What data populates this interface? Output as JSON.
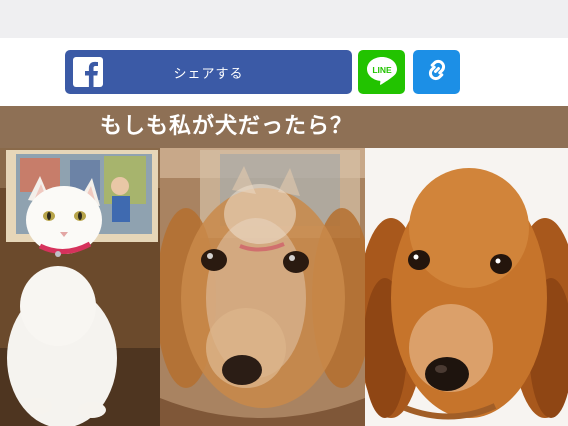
{
  "share": {
    "facebook": {
      "label": "シェアする",
      "icon": "facebook-f-icon",
      "color": "#3b5aa6"
    },
    "line": {
      "label": "LINE",
      "icon": "line-logo-icon",
      "color": "#22c300"
    },
    "copy_link": {
      "icon": "link-icon",
      "color": "#1c8fe6"
    }
  },
  "banner": {
    "title": "もしも私が犬だったら？",
    "color": "#8e7055"
  },
  "photos": [
    {
      "subject": "white-cat-photo"
    },
    {
      "subject": "cat-dog-morph-photo"
    },
    {
      "subject": "dachshund-photo"
    }
  ]
}
